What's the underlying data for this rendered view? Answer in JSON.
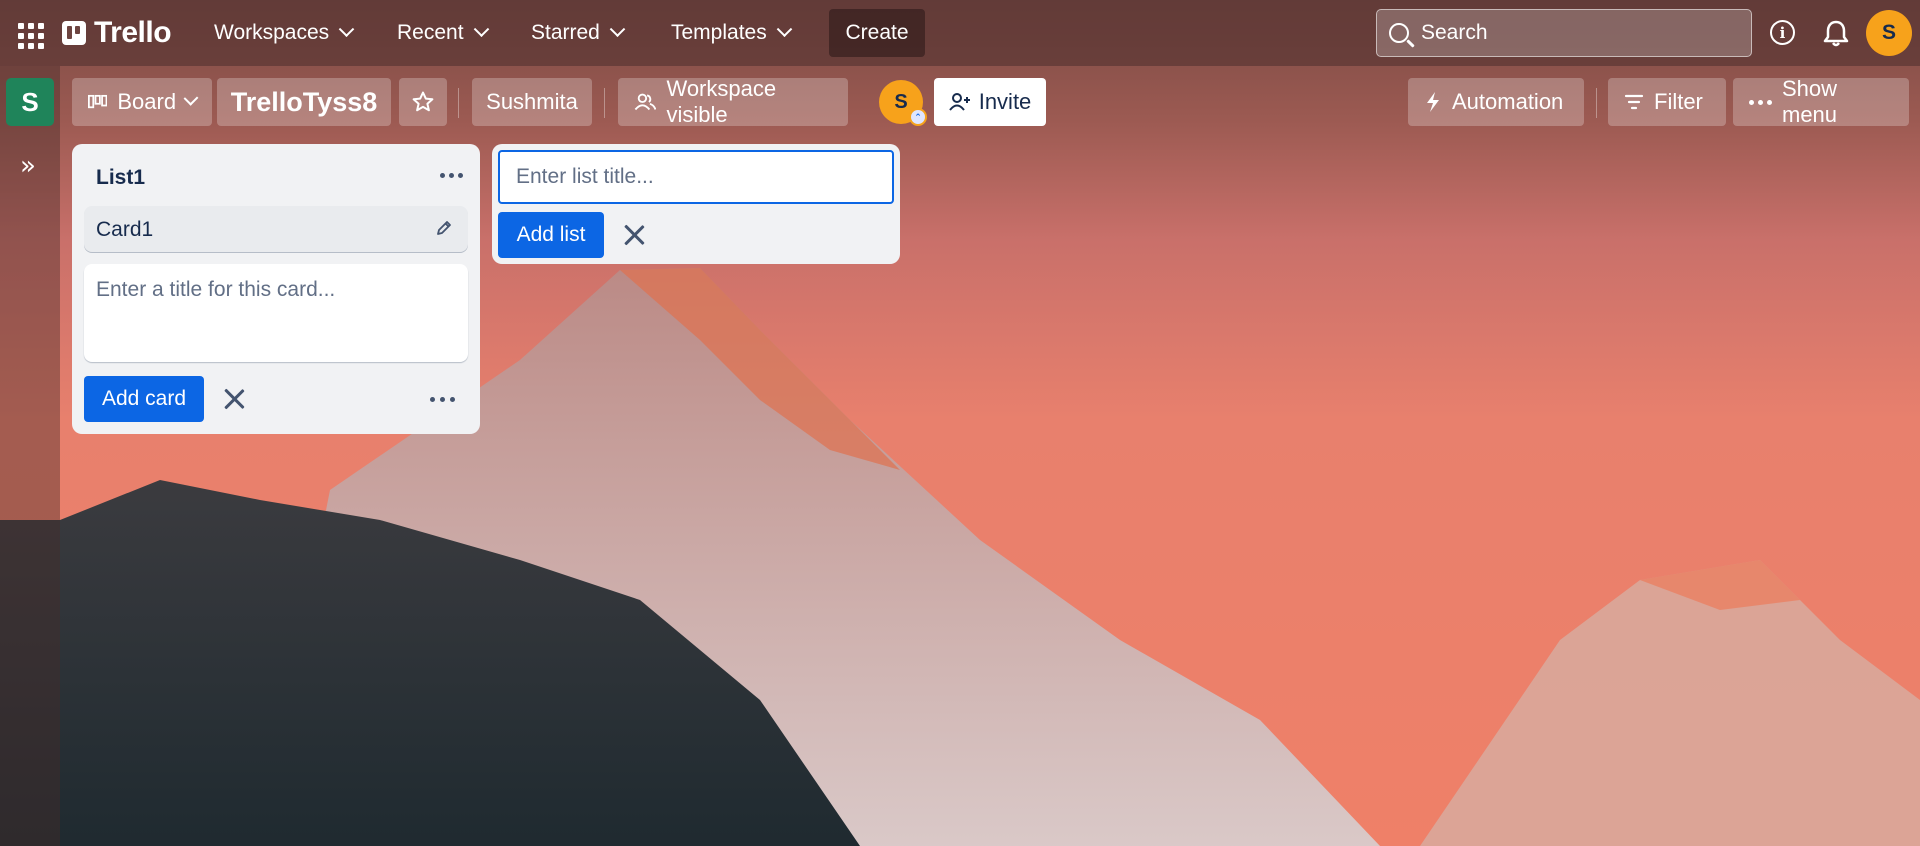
{
  "topnav": {
    "logo_text": "Trello",
    "menus": [
      {
        "label": "Workspaces"
      },
      {
        "label": "Recent"
      },
      {
        "label": "Starred"
      },
      {
        "label": "Templates"
      }
    ],
    "create_label": "Create",
    "search_placeholder": "Search",
    "avatar_initial": "S"
  },
  "sidebar": {
    "workspace_initial": "S",
    "expand_icon": "»"
  },
  "board": {
    "view_label": "Board",
    "title": "TrelloTyss8",
    "workspace_name": "Sushmita",
    "visibility_label": "Workspace visible",
    "member_initial": "S",
    "invite_label": "Invite",
    "automation_label": "Automation",
    "filter_label": "Filter",
    "show_menu_label": "Show menu"
  },
  "lists": [
    {
      "title": "List1",
      "cards": [
        {
          "title": "Card1"
        }
      ],
      "composer_placeholder": "Enter a title for this card...",
      "add_card_label": "Add card"
    }
  ],
  "list_composer": {
    "placeholder": "Enter list title...",
    "add_list_label": "Add list"
  },
  "colors": {
    "primary_button": "#0c66e4",
    "workspace_tile": "#1f845a",
    "avatar": "#f7a21b",
    "list_bg": "#f1f2f4"
  }
}
